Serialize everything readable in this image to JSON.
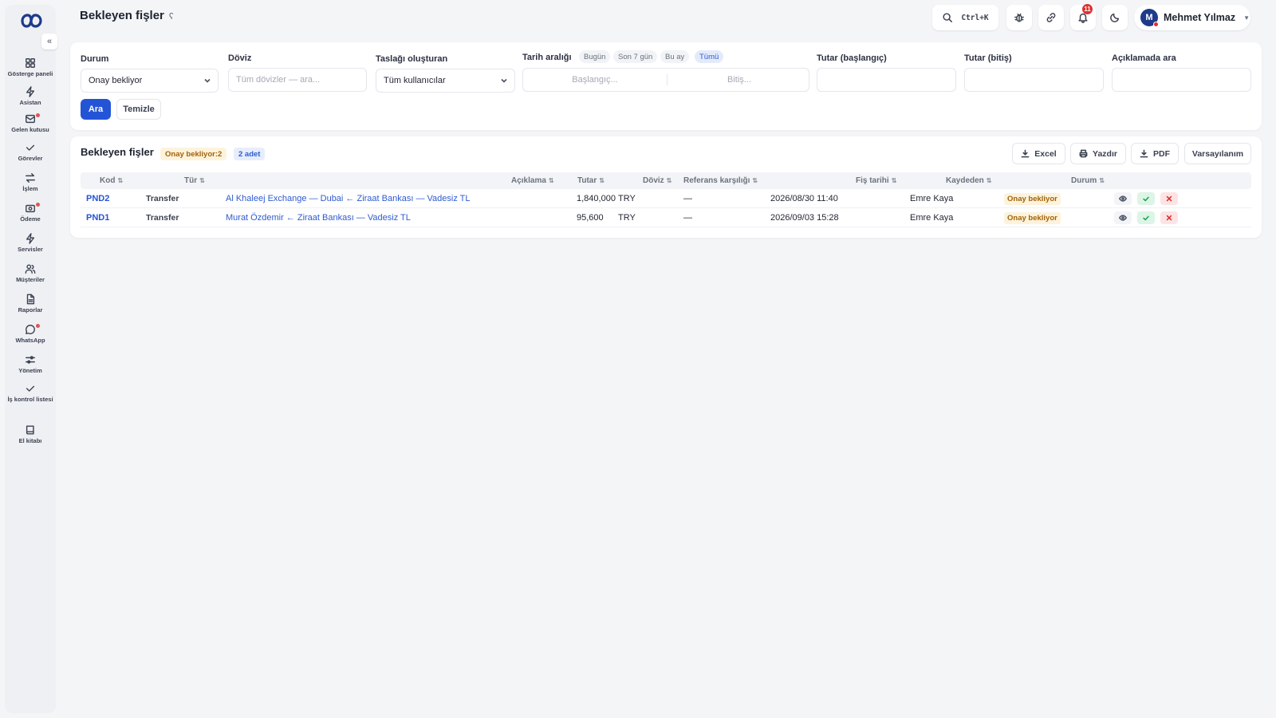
{
  "header": {
    "title": "Bekleyen fişler",
    "search_shortcut": "Ctrl+K",
    "notification_count": "11",
    "user_initial": "M",
    "user_name": "Mehmet Yılmaz"
  },
  "sidebar": {
    "items": [
      {
        "label": "Gösterge paneli",
        "icon": "dashboard-icon"
      },
      {
        "label": "Asistan",
        "icon": "bolt-icon"
      },
      {
        "label": "Gelen kutusu",
        "icon": "inbox-icon"
      },
      {
        "label": "Görevler",
        "icon": "check-icon"
      },
      {
        "label": "İşlem",
        "icon": "transfer-icon"
      },
      {
        "label": "Ödeme",
        "icon": "payment-icon"
      },
      {
        "label": "Servisler",
        "icon": "bolt-icon"
      },
      {
        "label": "Müşteriler",
        "icon": "users-icon"
      },
      {
        "label": "Raporlar",
        "icon": "report-icon"
      },
      {
        "label": "WhatsApp",
        "icon": "chat-icon"
      },
      {
        "label": "Yönetim",
        "icon": "sliders-icon"
      },
      {
        "label": "İş kontrol listesi",
        "icon": "checklist-icon"
      },
      {
        "label": "El kitabı",
        "icon": "book-icon"
      }
    ]
  },
  "filters": {
    "status_label": "Durum",
    "status_value": "Onay bekliyor",
    "currency_label": "Döviz",
    "currency_placeholder": "Tüm dövizler — ara...",
    "creator_label": "Taslağı oluşturan",
    "creator_value": "Tüm kullanıcılar",
    "date_label": "Tarih aralığı",
    "date_chips": [
      "Bugün",
      "Son 7 gün",
      "Bu ay",
      "Tümü"
    ],
    "date_start_placeholder": "Başlangıç...",
    "date_end_placeholder": "Bitiş...",
    "amount_start_label": "Tutar (başlangıç)",
    "amount_end_label": "Tutar (bitiş)",
    "desc_search_label": "Açıklamada ara",
    "search_button": "Ara",
    "clear_button": "Temizle"
  },
  "table": {
    "title": "Bekleyen fişler",
    "status_badge": "Onay bekliyor:2",
    "count_badge": "2 adet",
    "actions": {
      "excel": "Excel",
      "print": "Yazdır",
      "pdf": "PDF",
      "default": "Varsayılanım"
    },
    "columns": [
      "Kod",
      "Tür",
      "Açıklama",
      "Tutar",
      "Döviz",
      "Referans karşılığı",
      "Fiş tarihi",
      "Kaydeden",
      "Durum"
    ],
    "rows": [
      {
        "code": "PND2",
        "type": "Transfer",
        "description": "Al Khaleej Exchange — Dubai ← Ziraat Bankası — Vadesiz TL",
        "amount": "1,840,000",
        "currency": "TRY",
        "reference": "—",
        "date": "2026/08/30 11:40",
        "recorder": "Emre Kaya",
        "status": "Onay bekliyor"
      },
      {
        "code": "PND1",
        "type": "Transfer",
        "description": "Murat Özdemir ← Ziraat Bankası — Vadesiz TL",
        "amount": "95,600",
        "currency": "TRY",
        "reference": "—",
        "date": "2026/09/03 15:28",
        "recorder": "Emre Kaya",
        "status": "Onay bekliyor"
      }
    ]
  },
  "colors": {
    "accent": "#2454d6",
    "warning_bg": "#fdf3dc",
    "warning_text": "#a16207",
    "danger": "#e02f2f"
  }
}
